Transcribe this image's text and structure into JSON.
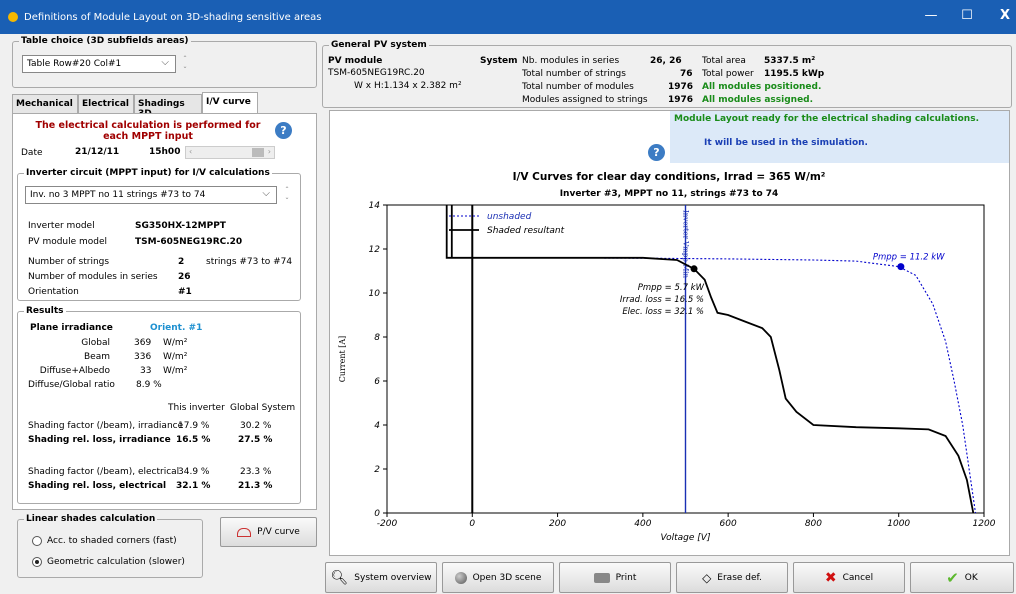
{
  "window": {
    "title": "Definitions of Module Layout on 3D-shading sensitive areas",
    "minimize": "—",
    "maximize": "☐",
    "close": "X"
  },
  "table_choice": {
    "legend": "Table choice  (3D subfields areas)",
    "value": "Table Row#20 Col#1"
  },
  "tabs": [
    "Mechanical",
    "Electrical",
    "Shadings 3D",
    "I/V curve"
  ],
  "mppt": {
    "msg": "The electrical calculation is performed for each MPPT input",
    "date_label": "Date",
    "date": "21/12/11",
    "hour": "15h00"
  },
  "inverter_circuit": {
    "legend": "Inverter circuit (MPPT input) for I/V calculations",
    "value": "Inv. no 3    MPPT no 11   strings #73 to 74",
    "inverter_model_label": "Inverter model",
    "inverter_model": "SG350HX-12MPPT",
    "pv_module_model_label": "PV module model",
    "pv_module_model": "TSM-605NEG19RC.20",
    "num_strings_label": "Number of strings",
    "num_strings": "2",
    "strings_range": "strings #73 to #74",
    "modules_series_label": "Number of modules in series",
    "modules_series": "26",
    "orientation_label": "Orientation",
    "orientation": "#1"
  },
  "results": {
    "legend": "Results",
    "plane_irr": "Plane irradiance",
    "orient": "Orient. #1",
    "global_label": "Global",
    "global": "369",
    "beam_label": "Beam",
    "beam": "336",
    "diffuse_label": "Diffuse+Albedo",
    "diffuse": "33",
    "unit": "W/m²",
    "ratio_label": "Diffuse/Global ratio",
    "ratio": "8.9 %",
    "col_this": "This inverter",
    "col_global": "Global System",
    "sf_irr_label": "Shading factor (/beam), irradiance",
    "sf_irr_this": "17.9 %",
    "sf_irr_global": "30.2 %",
    "sl_irr_label": "Shading rel. loss, irradiance",
    "sl_irr_this": "16.5 %",
    "sl_irr_global": "27.5 %",
    "sf_el_label": "Shading factor (/beam), electrical",
    "sf_el_this": "34.9 %",
    "sf_el_global": "23.3 %",
    "sl_el_label": "Shading rel. loss, electrical",
    "sl_el_this": "32.1 %",
    "sl_el_global": "21.3 %"
  },
  "linear": {
    "legend": "Linear shades calculation",
    "opt1": "Acc. to shaded corners (fast)",
    "opt2": "Geometric calculation (slower)",
    "pv_curve": "P/V curve"
  },
  "general": {
    "legend": "General PV system",
    "pv_module_label": "PV module",
    "pv_module": "TSM-605NEG19RC.20",
    "dims": "W x H:1.134 x 2.382 m²",
    "system_label": "System",
    "nb_series_label": "Nb. modules in series",
    "nb_series": "26, 26",
    "total_strings_label": "Total number of strings",
    "total_strings": "76",
    "total_modules_label": "Total number of modules",
    "total_modules": "1976",
    "assigned_label": "Modules assigned to strings",
    "assigned": "1976",
    "total_area_label": "Total area",
    "total_area": "5337.5 m²",
    "total_power_label": "Total power",
    "total_power": "1195.5 kWp",
    "positioned": "All modules positioned.",
    "all_assigned": "All modules assigned."
  },
  "status": {
    "line1": "Module Layout ready for the electrical shading calculations.",
    "line2": "It will be used in the simulation."
  },
  "chart_data": {
    "type": "line",
    "title": "I/V Curves for clear day conditions, Irrad = 365 W/m²",
    "subtitle": "Inverter #3, MPPT no 11, strings #73 to 74",
    "xlabel": "Voltage [V]",
    "ylabel": "Current [A]",
    "xlim": [
      -200,
      1200
    ],
    "ylim": [
      0,
      14
    ],
    "xticks": [
      -200,
      0,
      200,
      400,
      600,
      800,
      1000,
      1200
    ],
    "yticks": [
      0,
      2,
      4,
      6,
      8,
      10,
      12,
      14
    ],
    "vline_label": "Inverter Vmpp Min",
    "vline_x": 500,
    "series": [
      {
        "name": "unshaded",
        "color": "#0000cc",
        "dash": true,
        "points": [
          [
            0,
            11.6
          ],
          [
            200,
            11.6
          ],
          [
            400,
            11.58
          ],
          [
            600,
            11.55
          ],
          [
            800,
            11.5
          ],
          [
            900,
            11.45
          ],
          [
            960,
            11.3
          ],
          [
            1000,
            11.2
          ],
          [
            1040,
            10.8
          ],
          [
            1080,
            9.5
          ],
          [
            1110,
            7.8
          ],
          [
            1130,
            6
          ],
          [
            1150,
            4
          ],
          [
            1165,
            2
          ],
          [
            1180,
            0
          ]
        ]
      },
      {
        "name": "Shaded resultant",
        "color": "#000",
        "dash": false,
        "points": [
          [
            -60,
            14
          ],
          [
            -60,
            11.6
          ],
          [
            -48,
            11.6
          ],
          [
            -48,
            14
          ],
          [
            -48,
            11.6
          ],
          [
            400,
            11.6
          ],
          [
            480,
            11.5
          ],
          [
            520,
            11.1
          ],
          [
            545,
            10.6
          ],
          [
            560,
            9.8
          ],
          [
            575,
            9.1
          ],
          [
            600,
            9.0
          ],
          [
            640,
            8.7
          ],
          [
            680,
            8.4
          ],
          [
            700,
            8
          ],
          [
            720,
            6.5
          ],
          [
            735,
            5.2
          ],
          [
            760,
            4.6
          ],
          [
            800,
            4.0
          ],
          [
            900,
            3.9
          ],
          [
            1000,
            3.85
          ],
          [
            1070,
            3.8
          ],
          [
            1110,
            3.5
          ],
          [
            1140,
            2.6
          ],
          [
            1160,
            1.5
          ],
          [
            1175,
            0
          ]
        ]
      }
    ],
    "markers": [
      {
        "x": 520,
        "y": 11.1,
        "label": ""
      },
      {
        "x": 1005,
        "y": 11.2,
        "label": "Pmpp = 11.2 kW",
        "color": "#0000cc"
      }
    ],
    "annotations": [
      "Pmpp = 5.7 kW",
      "Irrad. loss = 16.5 %",
      "Elec. loss = 32.1 %"
    ]
  },
  "buttons": {
    "overview": "System overview",
    "open3d": "Open 3D scene",
    "print": "Print",
    "erase": "Erase def.",
    "cancel": "Cancel",
    "ok": "OK"
  }
}
